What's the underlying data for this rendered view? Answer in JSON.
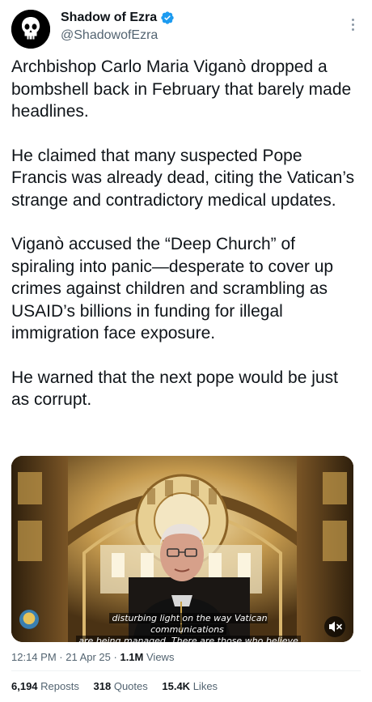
{
  "author": {
    "display_name": "Shadow of Ezra",
    "handle": "@ShadowofEzra",
    "avatar_icon": "punisher-skull-icon",
    "verified_color": "#1d9bf0"
  },
  "tweet": {
    "paragraphs": [
      "Archbishop Carlo Maria Viganò dropped a bombshell back in February that barely made headlines.",
      "He claimed that many suspected Pope Francis was already dead, citing the Vatican’s strange and contradictory medical updates.",
      "Viganò accused the “Deep Church” of spiraling into panic—desperate to cover up crimes against children and scrambling as USAID’s billions in funding for illegal immigration face exposure.",
      "He warned that the next pope would be just as corrupt."
    ]
  },
  "media": {
    "caption_line1": "disturbing light on the way Vatican communications",
    "caption_line2": "are being managed. There are those who believe",
    "mute_icon": "speaker-muted-icon"
  },
  "meta": {
    "time": "12:14 PM",
    "date": "21 Apr 25",
    "views_count": "1.1M",
    "views_label": "Views"
  },
  "stats": {
    "reposts_count": "6,194",
    "reposts_label": "Reposts",
    "quotes_count": "318",
    "quotes_label": "Quotes",
    "likes_count": "15.4K",
    "likes_label": "Likes"
  }
}
